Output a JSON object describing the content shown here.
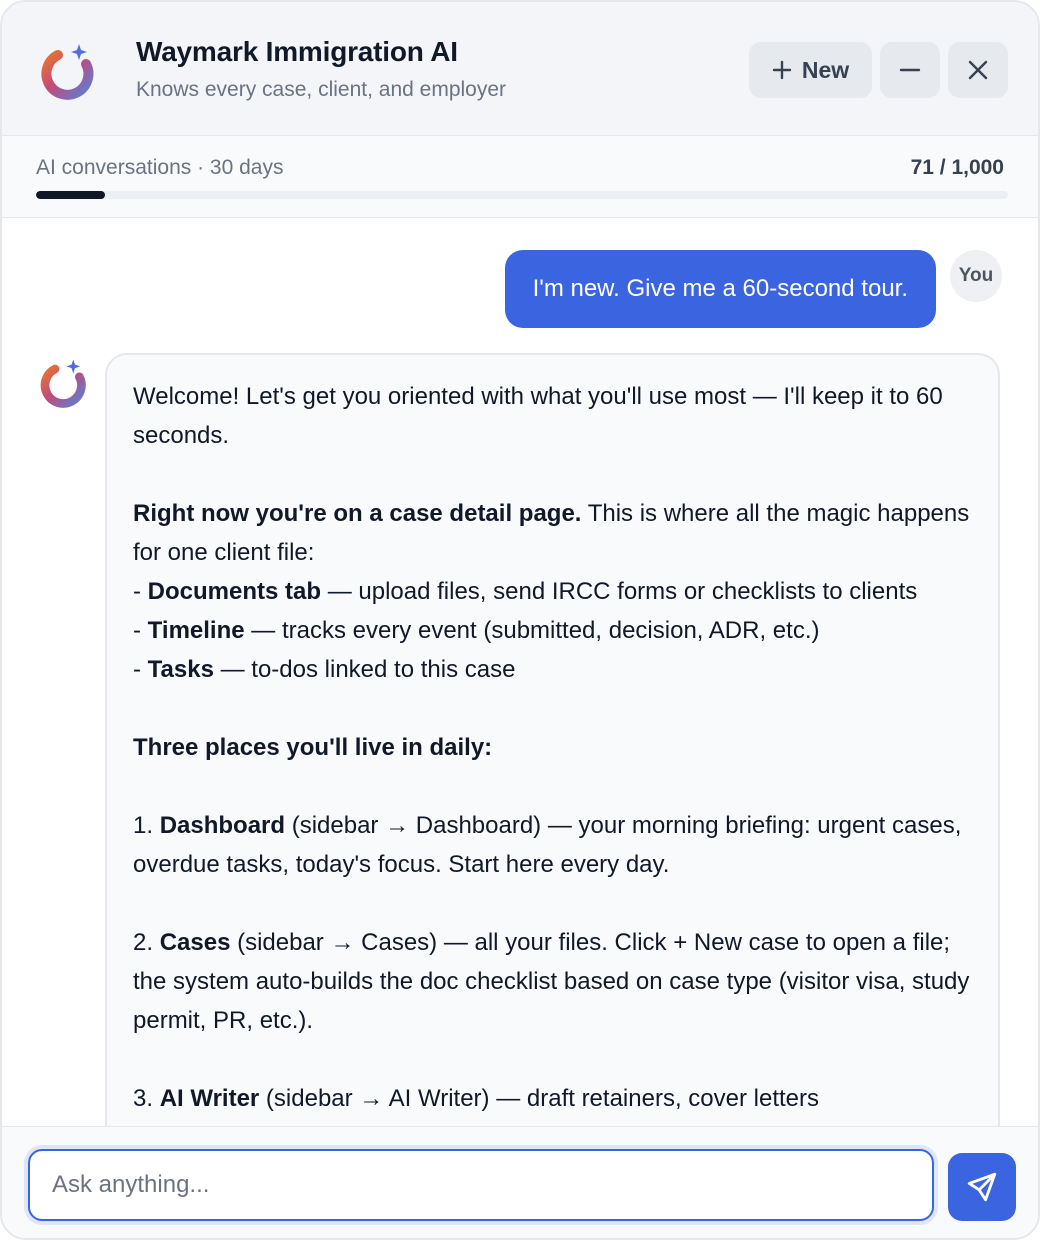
{
  "header": {
    "title": "Waymark Immigration AI",
    "subtitle": "Knows every case, client, and employer",
    "new_label": "New",
    "icons": {
      "logo": "waymark-logo-icon",
      "new": "plus-icon",
      "minimize": "minus-icon",
      "close": "close-icon"
    }
  },
  "usage": {
    "label": "AI conversations · 30 days",
    "count": "71 / 1,000",
    "used": 71,
    "limit": 1000
  },
  "messages": {
    "user": {
      "avatar": "You",
      "text": "I'm new. Give me a 60-second tour."
    },
    "assistant": {
      "p1": "Welcome! Let's get you oriented with what you'll use most — I'll keep it to 60 seconds.",
      "p2_bold": "Right now you're on a case detail page.",
      "p2_rest": " This is where all the magic happens for one client file:",
      "b1_prefix": "- ",
      "b1_bold": "Documents tab",
      "b1_rest": " — upload files, send IRCC forms or checklists to clients",
      "b2_prefix": "- ",
      "b2_bold": "Timeline",
      "b2_rest": " — tracks every event (submitted, decision, ADR, etc.)",
      "b3_prefix": "- ",
      "b3_bold": "Tasks",
      "b3_rest": " — to-dos linked to this case",
      "heading": "Three places you'll live in daily:",
      "n1_prefix": "1. ",
      "n1_bold": "Dashboard",
      "n1_rest": " (sidebar → Dashboard) — your morning briefing: urgent cases, overdue tasks, today's focus. Start here every day.",
      "n2_prefix": "2. ",
      "n2_bold": "Cases",
      "n2_rest": " (sidebar → Cases) — all your files. Click + New case to open a file; the system auto-builds the doc checklist based on case type (visitor visa, study permit, PR, etc.).",
      "n3_prefix": "3. ",
      "n3_bold": "AI Writer",
      "n3_rest": " (sidebar → AI Writer) — draft retainers, cover letters"
    }
  },
  "composer": {
    "placeholder": "Ask anything...",
    "value": "",
    "send_icon": "send-icon"
  },
  "colors": {
    "accent": "#3b64e0",
    "header_bg": "#f3f5f9",
    "progress_fill": "#111827"
  }
}
